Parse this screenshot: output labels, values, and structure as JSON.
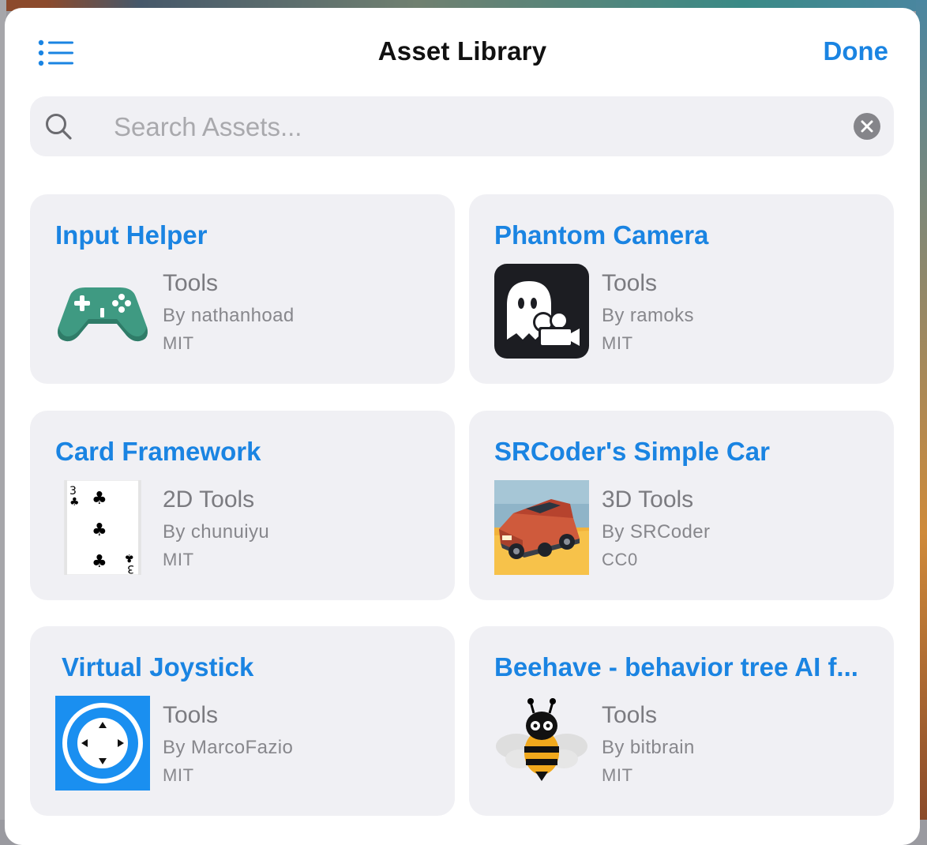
{
  "header": {
    "title": "Asset Library",
    "done_label": "Done",
    "menu_icon": "list-icon"
  },
  "search": {
    "placeholder": "Search Assets...",
    "value": "",
    "icon": "search-icon",
    "clear_icon": "clear-icon"
  },
  "assets": [
    {
      "title": "Input Helper",
      "category": "Tools",
      "author": "By nathanhoad",
      "license": "MIT",
      "icon": "gamepad-icon"
    },
    {
      "title": "Phantom Camera",
      "category": "Tools",
      "author": "By ramoks",
      "license": "MIT",
      "icon": "ghost-camera-icon"
    },
    {
      "title": "Card Framework",
      "category": "2D Tools",
      "author": "By chunuiyu",
      "license": "MIT",
      "icon": "playing-card-icon"
    },
    {
      "title": "SRCoder's Simple Car",
      "category": "3D Tools",
      "author": "By SRCoder",
      "license": "CC0",
      "icon": "car-icon"
    },
    {
      "title": "Virtual Joystick",
      "category": "Tools",
      "author": "By MarcoFazio",
      "license": "MIT",
      "icon": "joystick-icon"
    },
    {
      "title": "Beehave - behavior tree AI f...",
      "category": "Tools",
      "author": "By bitbrain",
      "license": "MIT",
      "icon": "bee-icon"
    }
  ],
  "colors": {
    "accent": "#1a84e2",
    "card_bg": "#f0f0f4",
    "meta_text": "#7b7b80"
  }
}
